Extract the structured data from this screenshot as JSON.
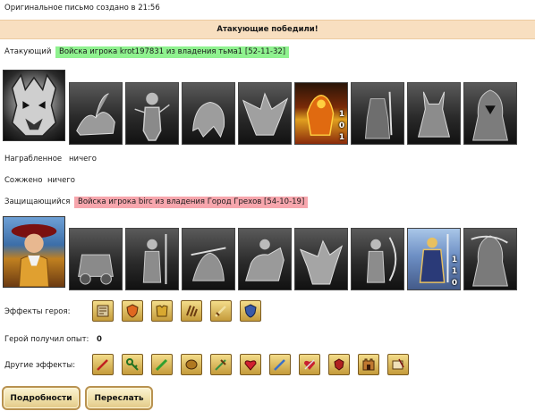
{
  "header": {
    "created_text": "Оригинальное письмо создано в 21:56",
    "result_banner": "Атакующие победили!"
  },
  "attacker": {
    "label": "Атакующий",
    "army_tag": "Войска игрока krot197831 из владения тьма1 [52-11-32]",
    "units": [
      {
        "icon": "dark-lord-icon"
      },
      {
        "icon": "scorpion-beast-icon"
      },
      {
        "icon": "skeleton-warrior-icon"
      },
      {
        "icon": "hunched-ghoul-icon"
      },
      {
        "icon": "dragon-icon"
      },
      {
        "icon": "fire-demon-icon",
        "count": [
          "1",
          "0",
          "1"
        ]
      },
      {
        "icon": "dark-knight-icon"
      },
      {
        "icon": "horned-demon-icon"
      },
      {
        "icon": "hooded-reaper-icon"
      }
    ]
  },
  "loot": {
    "label": "Награбленное",
    "value": "ничего"
  },
  "burned": {
    "label": "Сожжено",
    "value": "ничего"
  },
  "defender": {
    "label": "Защищающийся",
    "army_tag": "Войска игрока birc из владения Город Грехов [54-10-19]",
    "units": [
      {
        "icon": "hero-nobleman-icon"
      },
      {
        "icon": "siege-catapult-icon"
      },
      {
        "icon": "spearman-icon"
      },
      {
        "icon": "crossbowman-icon"
      },
      {
        "icon": "cavalry-knight-icon"
      },
      {
        "icon": "griffin-icon"
      },
      {
        "icon": "archer-icon"
      },
      {
        "icon": "monk-icon"
      },
      {
        "icon": "paladin-icon",
        "count": [
          "1",
          "1",
          "0"
        ]
      },
      {
        "icon": "reaper-icon"
      }
    ]
  },
  "hero_effects": {
    "label": "Эффекты героя:",
    "icons": [
      "scroll-map-icon",
      "orange-shield-icon",
      "golden-armor-icon",
      "claw-marks-icon",
      "golden-sword-icon",
      "blue-shield-icon"
    ]
  },
  "hero_exp": {
    "label": "Герой получил опыт:",
    "value": "0"
  },
  "other_effects": {
    "label": "Другие эффекты:",
    "icons": [
      "red-sword-icon",
      "green-key-icon",
      "green-blade-icon",
      "gold-shield-icon",
      "green-sword-icon",
      "heart-sword-icon",
      "blue-blade-icon",
      "red-heart-sword-icon",
      "red-sword-shield-icon",
      "castle-gate-icon",
      "scroll-quill-icon"
    ]
  },
  "buttons": {
    "details": "Подробности",
    "forward": "Переслать"
  }
}
